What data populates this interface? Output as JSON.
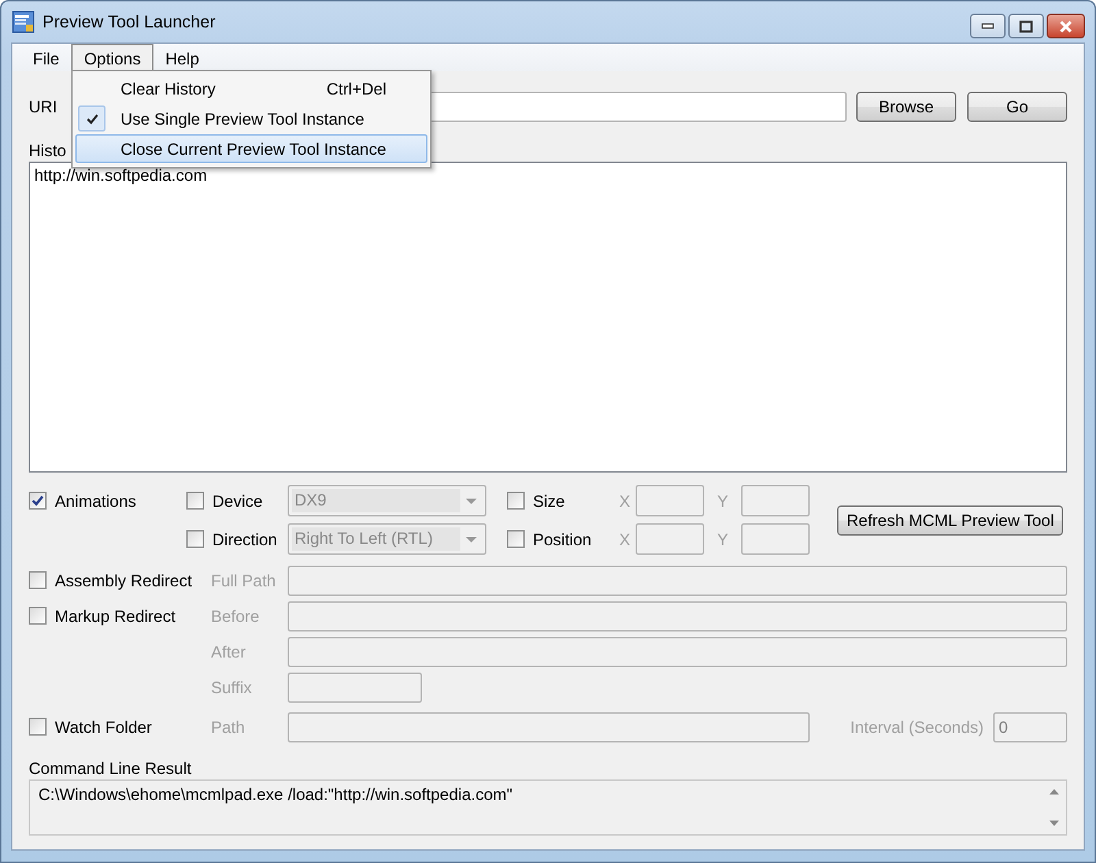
{
  "window": {
    "title": "Preview Tool Launcher"
  },
  "menu_bar": [
    {
      "label": "File",
      "selected": false
    },
    {
      "label": "Options",
      "selected": true
    },
    {
      "label": "Help",
      "selected": false
    }
  ],
  "options_menu": [
    {
      "label": "Clear History",
      "shortcut": "Ctrl+Del",
      "checked": false,
      "selected": false
    },
    {
      "label": "Use Single Preview Tool Instance",
      "checked": true,
      "selected": false
    },
    {
      "label": "Close Current Preview Tool Instance",
      "checked": false,
      "selected": true
    }
  ],
  "uri": {
    "label": "URI",
    "buttons": [
      "Browse",
      "Go"
    ]
  },
  "history": {
    "label": "Histo",
    "items": [
      "http://win.softpedia.com"
    ]
  },
  "animations": {
    "label": "Animations",
    "checked": true
  },
  "device": {
    "label": "Device",
    "checked": false,
    "value": "DX9"
  },
  "direction": {
    "label": "Direction",
    "checked": false,
    "value": "Right To Left (RTL)"
  },
  "size": {
    "label": "Size",
    "checked": false,
    "x_label": "X",
    "y_label": "Y"
  },
  "position": {
    "label": "Position",
    "checked": false,
    "x_label": "X",
    "y_label": "Y"
  },
  "refresh_button": "Refresh MCML Preview Tool",
  "assembly_redirect": {
    "label": "Assembly Redirect",
    "checked": false,
    "field_label": "Full Path"
  },
  "markup_redirect": {
    "label": "Markup Redirect",
    "checked": false,
    "field_labels": [
      "Before",
      "After",
      "Suffix"
    ]
  },
  "watch_folder": {
    "label": "Watch Folder",
    "checked": false,
    "path_label": "Path",
    "interval_label": "Interval (Seconds)",
    "interval_value": "0"
  },
  "command_line": {
    "label": "Command Line Result",
    "value": "C:\\Windows\\ehome\\mcmlpad.exe /load:\"http://win.softpedia.com\""
  }
}
